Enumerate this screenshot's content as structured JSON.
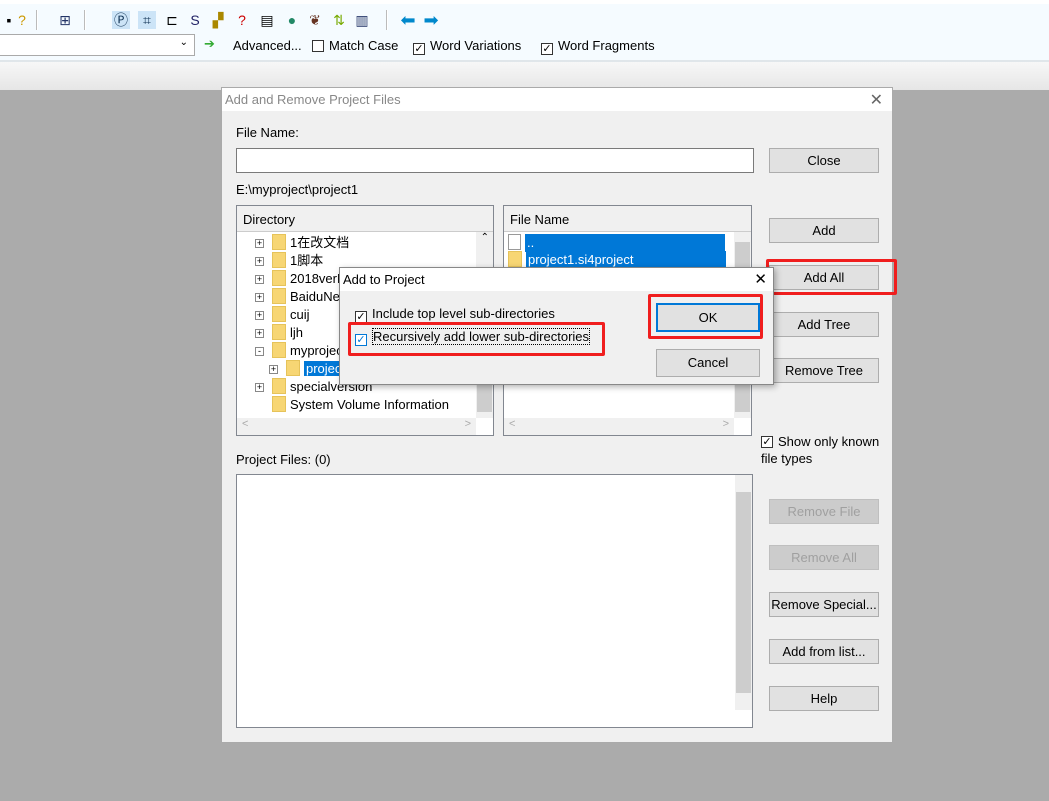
{
  "toolbar": {
    "icons": [
      "save-icon",
      "help-context-icon",
      "window-layout-icon",
      "project-icon",
      "symbol-window-icon",
      "relation-icon",
      "source-icon",
      "browse-icon",
      "keyword-icon",
      "context-icon",
      "globe-icon",
      "bird-icon",
      "sync-icon",
      "panel-icon",
      "back-arrow-icon",
      "forward-arrow-icon"
    ],
    "advanced_label": "Advanced...",
    "match_case": {
      "label": "Match Case",
      "checked": false
    },
    "word_variations": {
      "label": "Word Variations",
      "checked": true
    },
    "word_fragments": {
      "label": "Word Fragments",
      "checked": true
    }
  },
  "dialog": {
    "title": "Add and Remove Project Files",
    "file_name_label": "File Name:",
    "file_name_value": "",
    "path": "E:\\myproject\\project1",
    "directory_header": "Directory",
    "file_name_header": "File Name",
    "directories": [
      {
        "name": "1在改文档",
        "expander": "+"
      },
      {
        "name": "1脚本",
        "expander": "+"
      },
      {
        "name": "2018verP",
        "expander": "+"
      },
      {
        "name": "BaiduNet",
        "expander": "+"
      },
      {
        "name": "cuij",
        "expander": "+"
      },
      {
        "name": "ljh",
        "expander": "+"
      },
      {
        "name": "myprojec",
        "expander": "-"
      },
      {
        "name": "projec",
        "expander": "+",
        "selected": true,
        "child": true
      },
      {
        "name": "specialversion",
        "expander": "+"
      },
      {
        "name": "System Volume Information",
        "expander": ""
      }
    ],
    "files": [
      {
        "name": "..",
        "type": "file"
      },
      {
        "name": "project1.si4project",
        "type": "folder"
      }
    ],
    "show_known": {
      "label": "Show only known file types",
      "checked": true
    },
    "project_files_label": "Project Files: (0)",
    "buttons": {
      "close": "Close",
      "add": "Add",
      "add_all": "Add All",
      "add_tree": "Add Tree",
      "remove_tree": "Remove Tree",
      "remove_file": "Remove File",
      "remove_all": "Remove All",
      "remove_special": "Remove Special...",
      "add_from_list": "Add from list...",
      "help": "Help"
    }
  },
  "add_to_project": {
    "title": "Add to Project",
    "include_top": {
      "label": "Include top level sub-directories",
      "checked": true
    },
    "recursive": {
      "label": "Recursively add lower sub-directories",
      "checked": true
    },
    "ok": "OK",
    "cancel": "Cancel"
  },
  "colors": {
    "highlight": "#f01e1e",
    "selection": "#0078d7"
  }
}
